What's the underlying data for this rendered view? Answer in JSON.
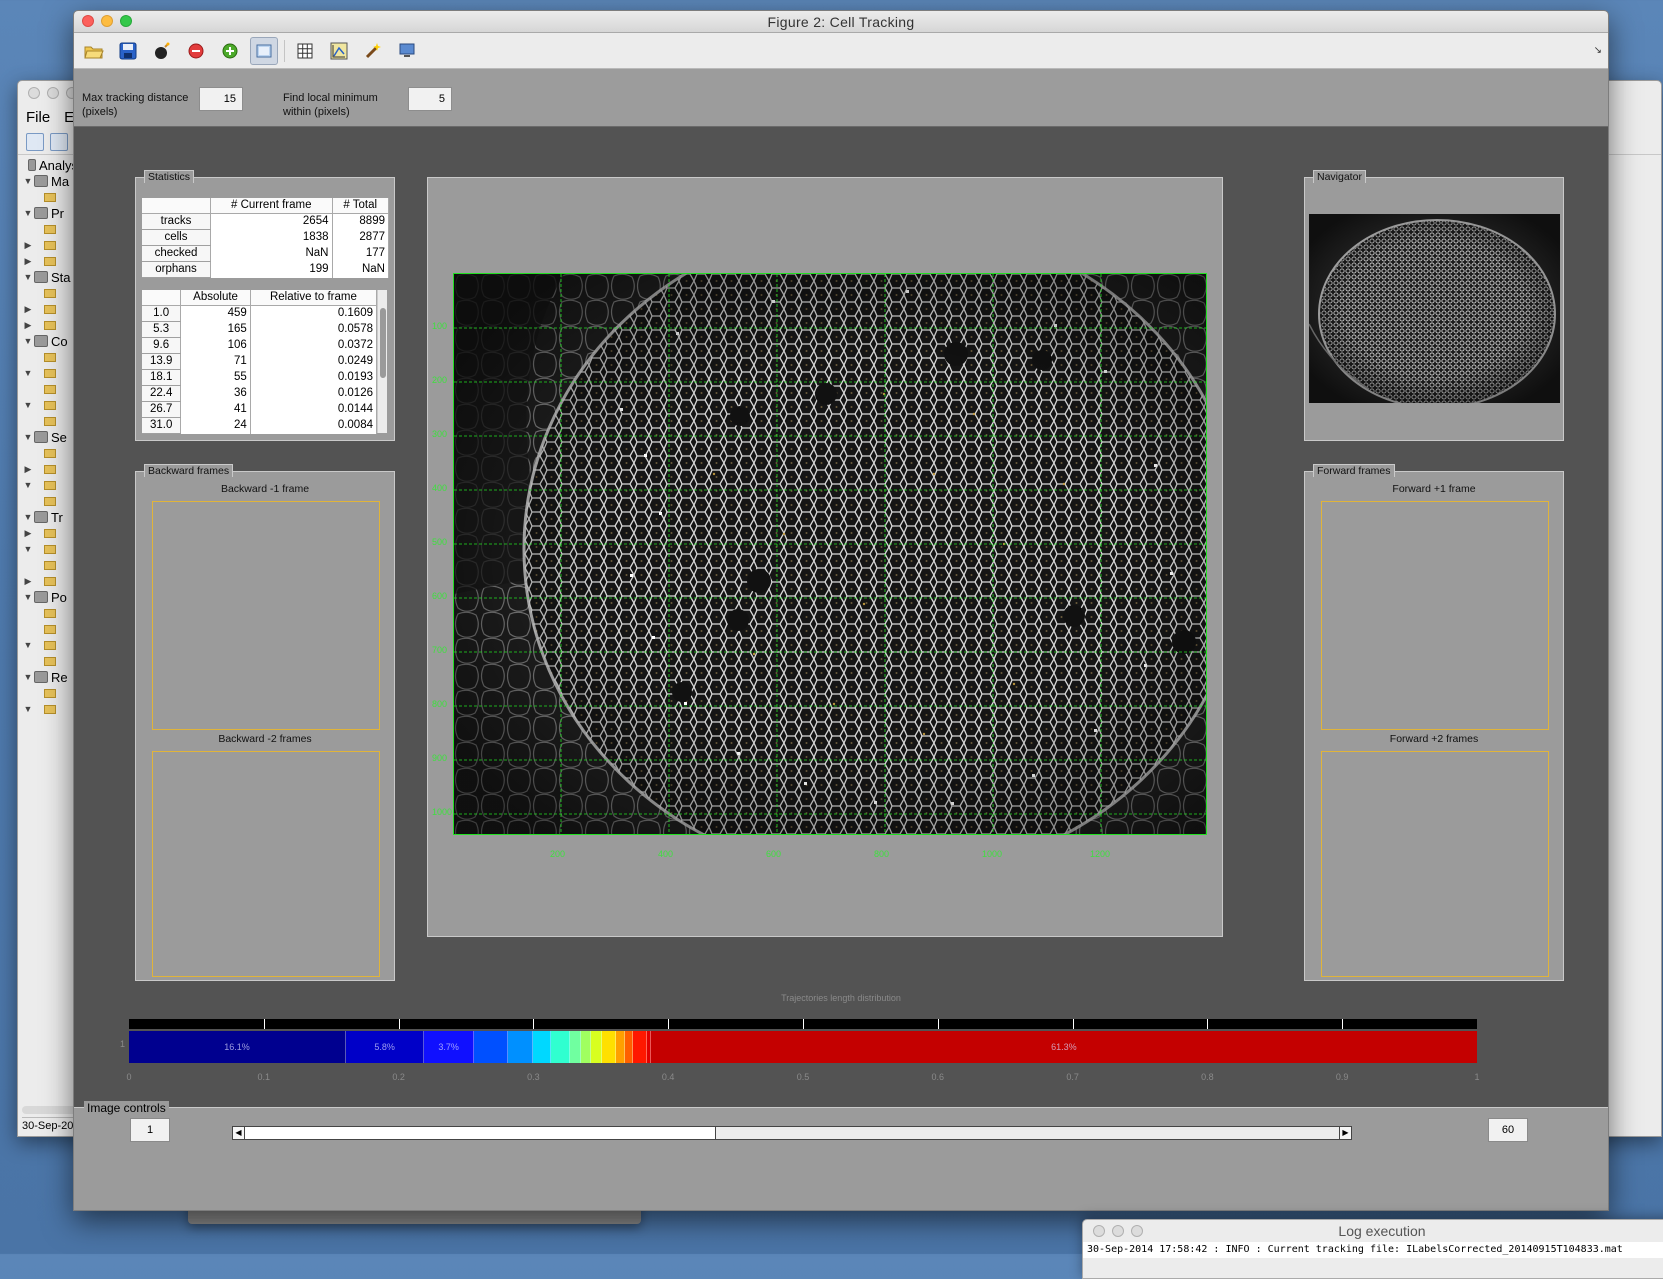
{
  "bg_window": {
    "menu": [
      "File",
      "E"
    ],
    "tree": [
      {
        "tri": "",
        "kind": "cube",
        "label": "Analys"
      },
      {
        "tri": "▼",
        "kind": "cube",
        "label": "Ma"
      },
      {
        "tri": "",
        "kind": "folder",
        "label": ""
      },
      {
        "tri": "▼",
        "kind": "cube",
        "label": "Pr"
      },
      {
        "tri": "",
        "kind": "folder",
        "label": ""
      },
      {
        "tri": "▶",
        "kind": "folder",
        "label": ""
      },
      {
        "tri": "▶",
        "kind": "folder",
        "label": ""
      },
      {
        "tri": "▼",
        "kind": "cube",
        "label": "Sta"
      },
      {
        "tri": "",
        "kind": "folder",
        "label": ""
      },
      {
        "tri": "▶",
        "kind": "folder",
        "label": ""
      },
      {
        "tri": "▶",
        "kind": "folder",
        "label": ""
      },
      {
        "tri": "▼",
        "kind": "cube",
        "label": "Co"
      },
      {
        "tri": "",
        "kind": "folder",
        "label": ""
      },
      {
        "tri": "▼",
        "kind": "folder",
        "label": ""
      },
      {
        "tri": "",
        "kind": "folder",
        "label": ""
      },
      {
        "tri": "▼",
        "kind": "folder",
        "label": ""
      },
      {
        "tri": "",
        "kind": "folder",
        "label": ""
      },
      {
        "tri": "▼",
        "kind": "cube",
        "label": "Se"
      },
      {
        "tri": "",
        "kind": "folder",
        "label": ""
      },
      {
        "tri": "▶",
        "kind": "folder",
        "label": ""
      },
      {
        "tri": "▼",
        "kind": "folder",
        "label": ""
      },
      {
        "tri": "",
        "kind": "folder",
        "label": ""
      },
      {
        "tri": "▼",
        "kind": "cube",
        "label": "Tr"
      },
      {
        "tri": "▶",
        "kind": "folder",
        "label": ""
      },
      {
        "tri": "▼",
        "kind": "folder",
        "label": ""
      },
      {
        "tri": "",
        "kind": "folder",
        "label": ""
      },
      {
        "tri": "▶",
        "kind": "folder",
        "label": ""
      },
      {
        "tri": "▼",
        "kind": "cube",
        "label": "Po"
      },
      {
        "tri": "",
        "kind": "folder",
        "label": ""
      },
      {
        "tri": "",
        "kind": "folder",
        "label": ""
      },
      {
        "tri": "▼",
        "kind": "folder",
        "label": ""
      },
      {
        "tri": "",
        "kind": "folder",
        "label": ""
      },
      {
        "tri": "▼",
        "kind": "cube",
        "label": "Re"
      },
      {
        "tri": "",
        "kind": "folder",
        "label": ""
      },
      {
        "tri": "▼",
        "kind": "folder",
        "label": ""
      }
    ],
    "status": "30-Sep-20"
  },
  "log_window": {
    "title": "Log execution",
    "line": "30-Sep-2014 17:58:42 : INFO :  Current tracking file: ILabelsCorrected_20140915T104833.mat"
  },
  "window": {
    "title": "Figure 2: Cell Tracking"
  },
  "toolbar": {
    "icons": [
      "open-folder-icon",
      "save-icon",
      "bomb-icon",
      "stop-icon",
      "add-circle-icon",
      "view-icon",
      "grid-icon",
      "axes-icon",
      "wand-icon",
      "monitor-icon"
    ]
  },
  "params": {
    "max_dist_label_1": "Max tracking distance",
    "max_dist_label_2": "(pixels)",
    "max_dist_value": "15",
    "local_min_label_1": "Find local minimum",
    "local_min_label_2": "within (pixels)",
    "local_min_value": "5"
  },
  "statistics": {
    "title": "Statistics",
    "headers": [
      "",
      "# Current frame",
      "# Total"
    ],
    "rows": [
      {
        "name": "tracks",
        "current": "2654",
        "total": "8899"
      },
      {
        "name": "cells",
        "current": "1838",
        "total": "2877"
      },
      {
        "name": "checked",
        "current": "NaN",
        "total": "177"
      },
      {
        "name": "orphans",
        "current": "199",
        "total": "NaN"
      }
    ],
    "dist_headers": [
      "",
      "Absolute",
      "Relative to frame"
    ],
    "dist_rows": [
      {
        "bin": "1.0",
        "abs": "459",
        "rel": "0.1609"
      },
      {
        "bin": "5.3",
        "abs": "165",
        "rel": "0.0578"
      },
      {
        "bin": "9.6",
        "abs": "106",
        "rel": "0.0372"
      },
      {
        "bin": "13.9",
        "abs": "71",
        "rel": "0.0249"
      },
      {
        "bin": "18.1",
        "abs": "55",
        "rel": "0.0193"
      },
      {
        "bin": "22.4",
        "abs": "36",
        "rel": "0.0126"
      },
      {
        "bin": "26.7",
        "abs": "41",
        "rel": "0.0144"
      },
      {
        "bin": "31.0",
        "abs": "24",
        "rel": "0.0084"
      }
    ]
  },
  "backward": {
    "title": "Backward frames",
    "label1": "Backward -1 frame",
    "label2": "Backward -2 frames"
  },
  "forward": {
    "title": "Forward frames",
    "label1": "Forward +1 frame",
    "label2": "Forward +2 frames"
  },
  "navigator": {
    "title": "Navigator"
  },
  "image_axes": {
    "x_ticks": [
      "200",
      "400",
      "600",
      "800",
      "1000",
      "1200"
    ],
    "y_ticks": [
      "100",
      "200",
      "300",
      "400",
      "500",
      "600",
      "700",
      "800",
      "900",
      "1000"
    ]
  },
  "trajectories": {
    "title": "Trajectories length distribution",
    "y_label": "1",
    "segments": [
      {
        "frac": 0.161,
        "color": "#00008f",
        "label": "16.1%"
      },
      {
        "frac": 0.058,
        "color": "#0000c8",
        "label": "5.8%"
      },
      {
        "frac": 0.037,
        "color": "#1010ff",
        "label": "3.7%"
      },
      {
        "frac": 0.025,
        "color": "#0050ff",
        "label": ""
      },
      {
        "frac": 0.019,
        "color": "#0090ff",
        "label": ""
      },
      {
        "frac": 0.013,
        "color": "#00d8ff",
        "label": ""
      },
      {
        "frac": 0.014,
        "color": "#30ffd0",
        "label": ""
      },
      {
        "frac": 0.008,
        "color": "#70ffa0",
        "label": ""
      },
      {
        "frac": 0.008,
        "color": "#a0ff60",
        "label": ""
      },
      {
        "frac": 0.008,
        "color": "#d8ff20",
        "label": ""
      },
      {
        "frac": 0.01,
        "color": "#ffe000",
        "label": ""
      },
      {
        "frac": 0.007,
        "color": "#ffa000",
        "label": ""
      },
      {
        "frac": 0.006,
        "color": "#ff6000",
        "label": ""
      },
      {
        "frac": 0.01,
        "color": "#ff1800",
        "label": ""
      },
      {
        "frac": 0.003,
        "color": "#e00000",
        "label": ""
      },
      {
        "frac": 0.613,
        "color": "#c40000",
        "label": "61.3%"
      }
    ],
    "x_ticks": [
      "0",
      "0.1",
      "0.2",
      "0.3",
      "0.4",
      "0.5",
      "0.6",
      "0.7",
      "0.8",
      "0.9",
      "1"
    ]
  },
  "controls": {
    "title": "Image controls",
    "start_frame": "1",
    "end_frame": "60",
    "slider_value": 0.43
  }
}
